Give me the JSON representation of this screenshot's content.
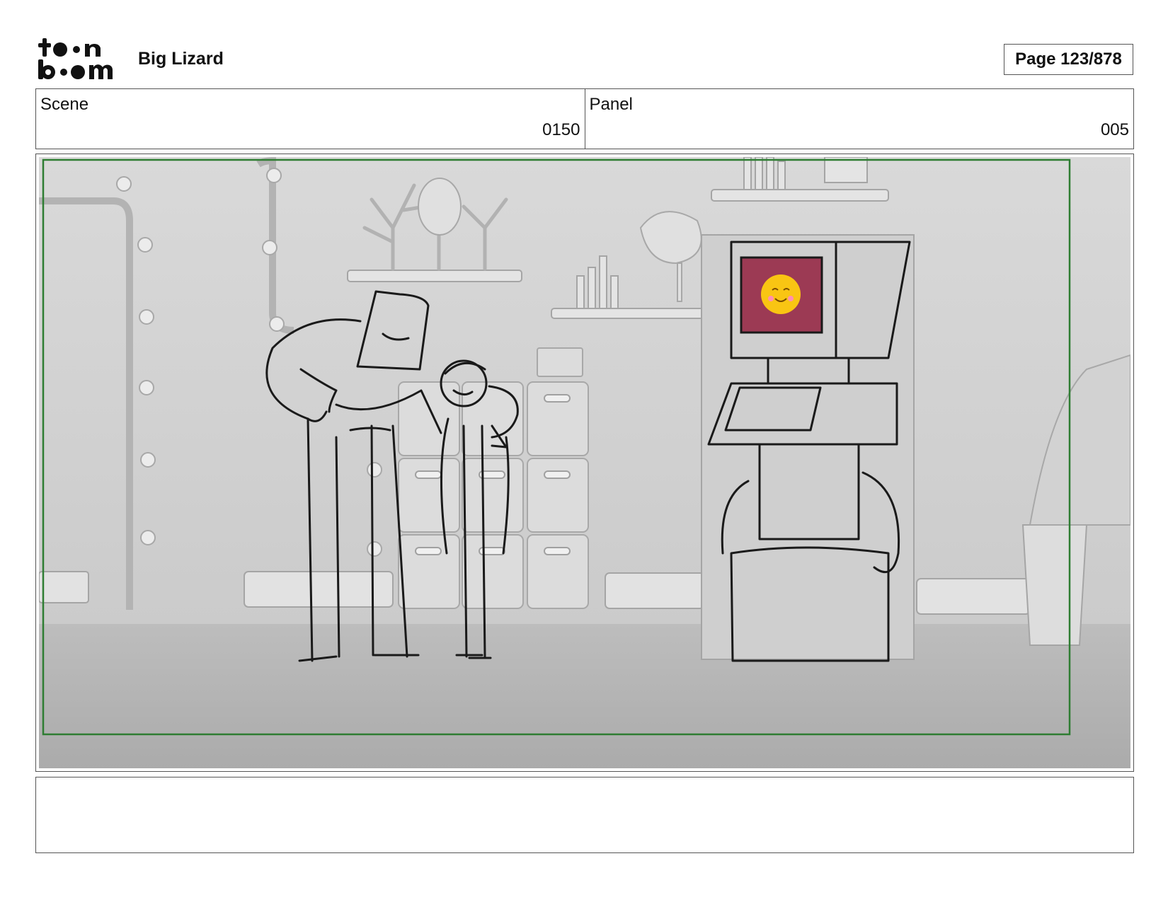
{
  "header": {
    "logo_name": "toon boom",
    "project_title": "Big Lizard",
    "page_indicator": "Page 123/878"
  },
  "info": {
    "scene_label": "Scene",
    "scene_value": "0150",
    "panel_label": "Panel",
    "panel_value": "005"
  },
  "panel": {
    "safe_frame_color": "#2e7d32",
    "screen_color": "#9c3a54",
    "face_color": "#f9c513"
  },
  "notes": {
    "text": ""
  }
}
